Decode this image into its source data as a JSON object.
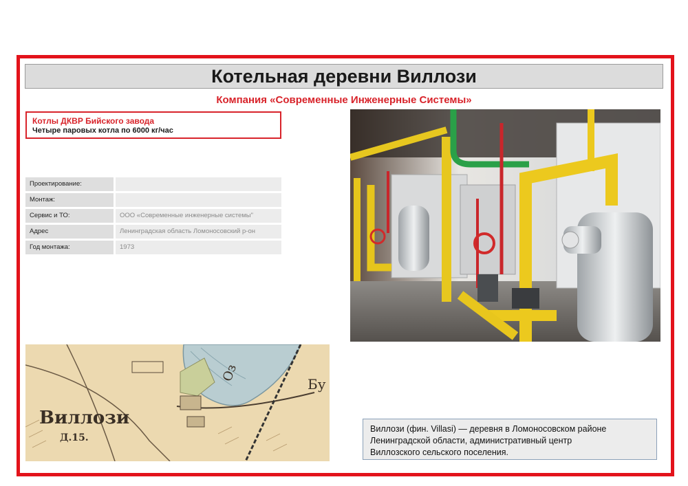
{
  "title": "Котельная деревни Виллози",
  "company": "Компания «Современные Инженерные Системы»",
  "boilers": {
    "heading": "Котлы ДКВР Бийского завода",
    "description": "Четыре паровых котла по 6000 кг/час"
  },
  "info_rows": [
    {
      "label": "Проектирование:",
      "value": ""
    },
    {
      "label": "Монтаж:",
      "value": ""
    },
    {
      "label": "Сервис и ТО:",
      "value": "ООО «Современные инженерные системы\""
    },
    {
      "label": "Адрес",
      "value": "Ленинградская область Ломоносовский р-он"
    },
    {
      "label": "Год монтажа:",
      "value": "1973"
    }
  ],
  "map": {
    "village_label": "Виллози",
    "houses_label": "Д.15.",
    "lake_label": "Оз",
    "side_label": "Бу"
  },
  "note": {
    "line1": "Виллози (фин. Villasi) — деревня в Ломоносовском районе",
    "line2": "Ленинградской области, административный центр",
    "line3": "Виллозского сельского поселения."
  },
  "colors": {
    "accent_red": "#e3131b",
    "title_bg": "#dcdcdc"
  }
}
